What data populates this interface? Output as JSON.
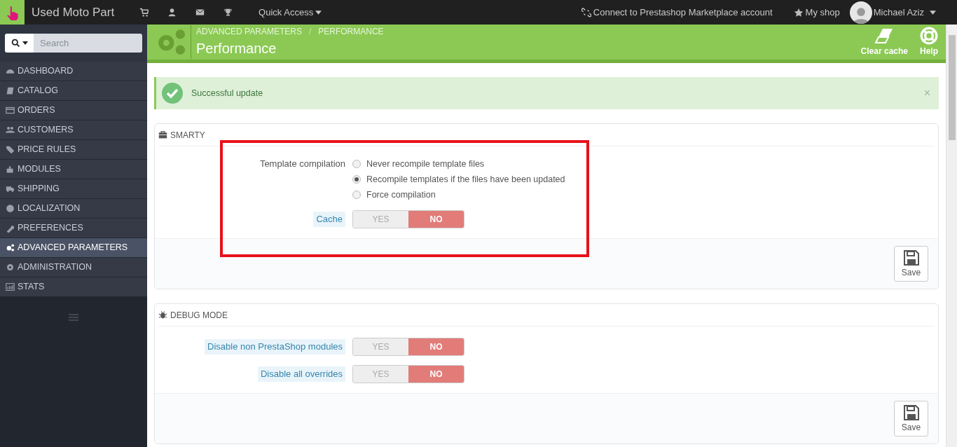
{
  "topbar": {
    "shop_name": "Used Moto Part",
    "quick_access": "Quick Access",
    "connect": "Connect to Prestashop Marketplace account",
    "my_shop": "My shop",
    "user": "Michael Aziz"
  },
  "sidebar": {
    "search_placeholder": "Search",
    "items": [
      {
        "label": "DASHBOARD",
        "selected": false
      },
      {
        "label": "CATALOG",
        "selected": false
      },
      {
        "label": "ORDERS",
        "selected": false
      },
      {
        "label": "CUSTOMERS",
        "selected": false
      },
      {
        "label": "PRICE RULES",
        "selected": false
      },
      {
        "label": "MODULES",
        "selected": false
      },
      {
        "label": "SHIPPING",
        "selected": false
      },
      {
        "label": "LOCALIZATION",
        "selected": false
      },
      {
        "label": "PREFERENCES",
        "selected": false
      },
      {
        "label": "ADVANCED PARAMETERS",
        "selected": true
      },
      {
        "label": "ADMINISTRATION",
        "selected": false
      },
      {
        "label": "STATS",
        "selected": false
      }
    ]
  },
  "header": {
    "breadcrumb": [
      "ADVANCED PARAMETERS",
      "/",
      "PERFORMANCE"
    ],
    "title": "Performance",
    "actions": [
      {
        "label": "Clear cache"
      },
      {
        "label": "Help"
      }
    ]
  },
  "alert": {
    "message": "Successful update",
    "close": "×"
  },
  "panels": [
    {
      "title": "SMARTY",
      "highlighted": true,
      "fields": [
        {
          "kind": "radio",
          "label": "Template compilation",
          "options": [
            {
              "label": "Never recompile template files",
              "selected": false
            },
            {
              "label": "Recompile templates if the files have been updated",
              "selected": true
            },
            {
              "label": "Force compilation",
              "selected": false
            }
          ]
        },
        {
          "kind": "switch",
          "label": "Cache",
          "options": [
            {
              "label": "YES",
              "selected": false
            },
            {
              "label": "NO",
              "selected": true
            }
          ]
        }
      ],
      "save": "Save"
    },
    {
      "title": "DEBUG MODE",
      "highlighted": false,
      "fields": [
        {
          "kind": "switch",
          "label": "Disable non PrestaShop modules",
          "options": [
            {
              "label": "YES",
              "selected": false
            },
            {
              "label": "NO",
              "selected": true
            }
          ]
        },
        {
          "kind": "switch",
          "label": "Disable all overrides",
          "options": [
            {
              "label": "YES",
              "selected": false
            },
            {
              "label": "NO",
              "selected": true
            }
          ]
        }
      ],
      "save": "Save"
    }
  ]
}
